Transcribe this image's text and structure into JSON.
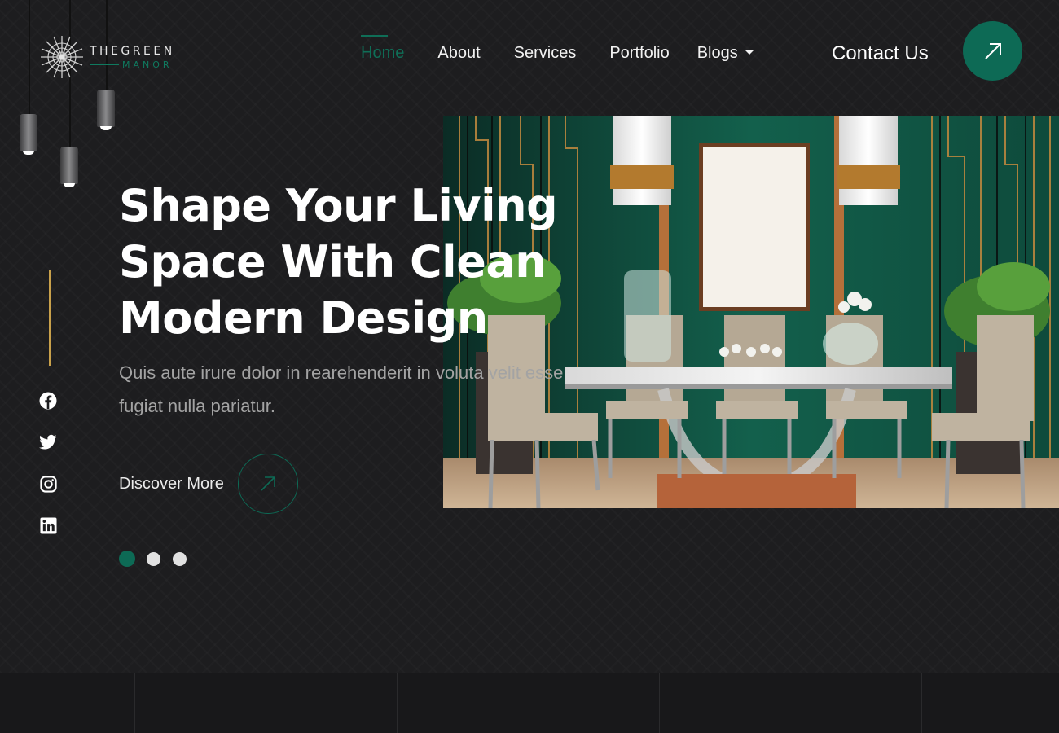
{
  "brand": {
    "name_top": "THEGREEN",
    "name_bottom": "MANOR"
  },
  "nav": {
    "items": [
      {
        "label": "Home",
        "active": true
      },
      {
        "label": "About",
        "active": false
      },
      {
        "label": "Services",
        "active": false
      },
      {
        "label": "Portfolio",
        "active": false
      },
      {
        "label": "Blogs",
        "active": false,
        "has_dropdown": true
      }
    ],
    "contact_label": "Contact Us",
    "contact_icon": "arrow-up-right-icon"
  },
  "hero": {
    "headline": [
      "Shape Your Living",
      "Space With Clean",
      "Modern Design"
    ],
    "subtext": "Quis aute irure dolor in rearehenderit in voluta velit esse fugiat nulla pariatur.",
    "cta_label": "Discover More",
    "cta_icon": "arrow-up-right-icon",
    "slides": {
      "count": 3,
      "active_index": 0
    }
  },
  "socials": [
    "facebook-icon",
    "twitter-icon",
    "instagram-icon",
    "linkedin-icon"
  ],
  "colors": {
    "accent": "#0d6a55",
    "background": "#1d1d1f",
    "gold": "#c9a14b",
    "muted_text": "#a3a3a3"
  }
}
